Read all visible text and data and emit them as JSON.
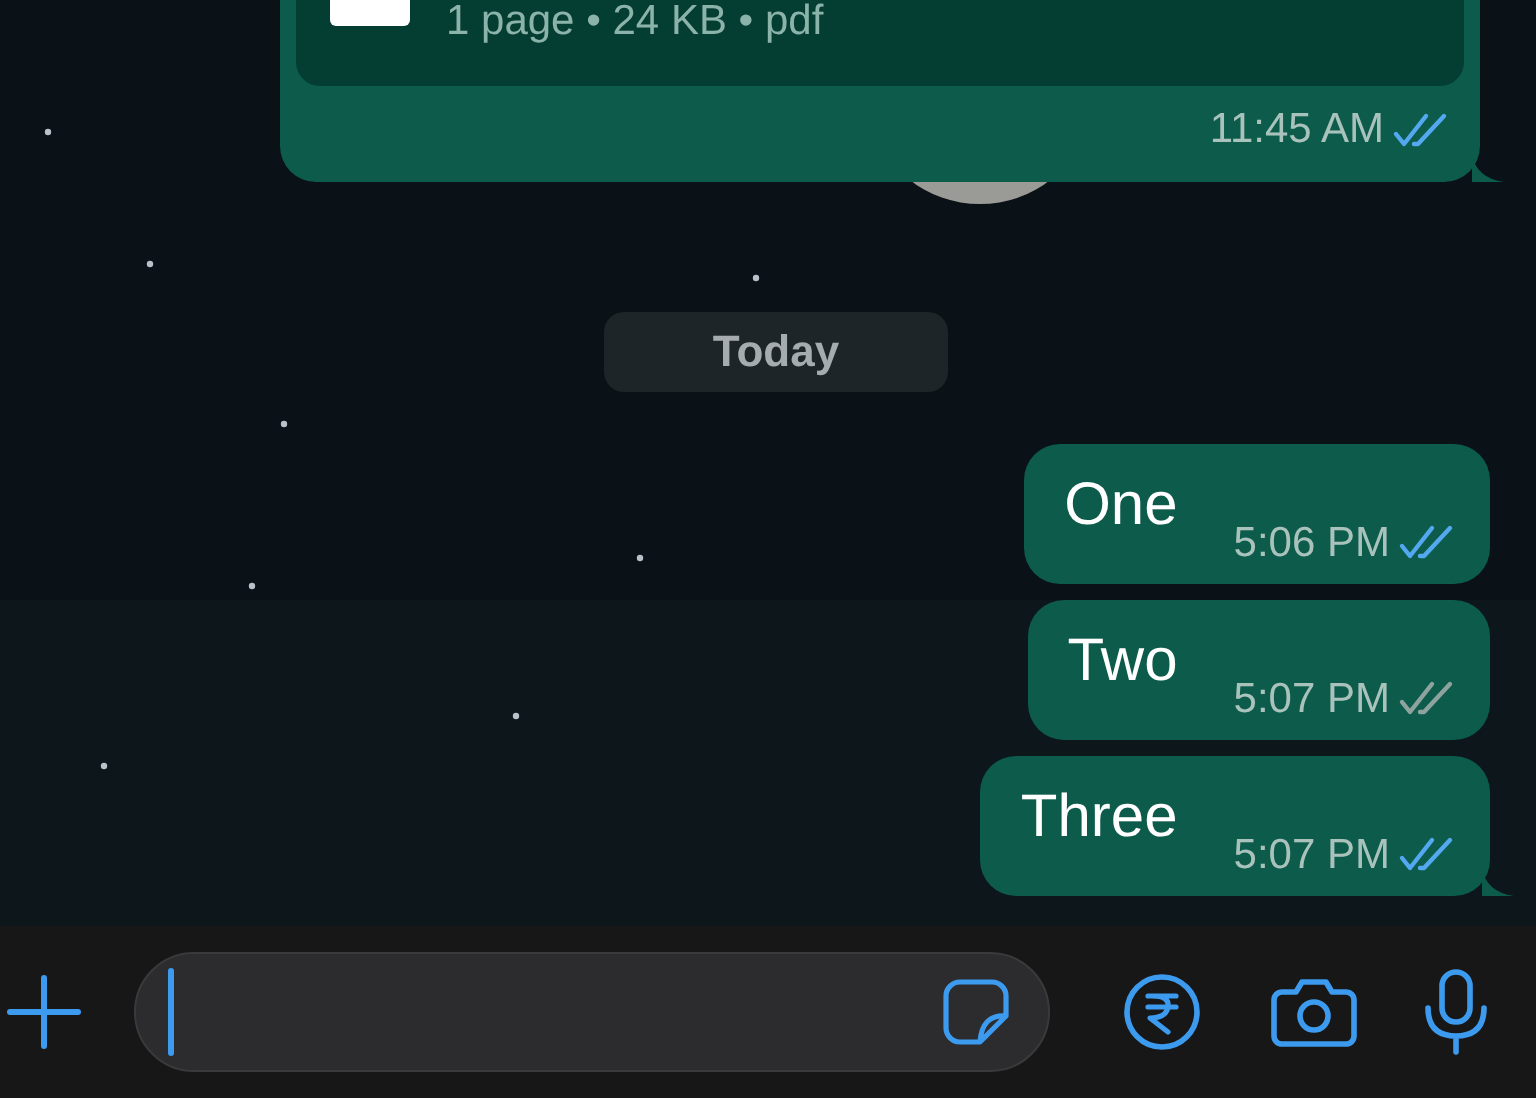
{
  "messages": [
    {
      "kind": "document",
      "meta": "1 page • 24 KB • pdf",
      "time": "11:45 AM",
      "read": true,
      "tail": true
    },
    {
      "kind": "date",
      "label": "Today"
    },
    {
      "kind": "text",
      "text": "One",
      "time": "5:06 PM",
      "read": true,
      "tail": false
    },
    {
      "kind": "text",
      "text": "Two",
      "time": "5:07 PM",
      "read": false,
      "tail": false
    },
    {
      "kind": "text",
      "text": "Three",
      "time": "5:07 PM",
      "read": true,
      "tail": true
    }
  ]
}
